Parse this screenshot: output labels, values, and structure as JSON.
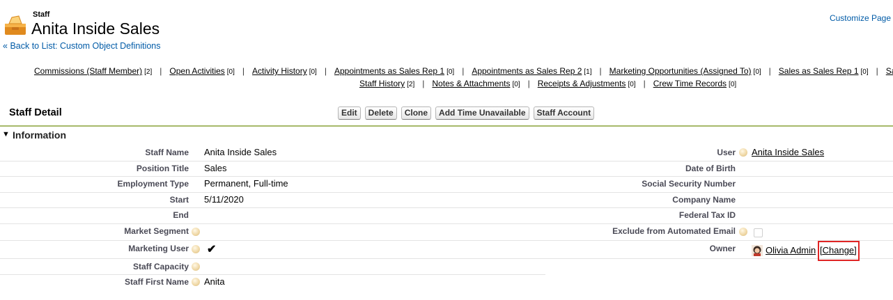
{
  "header": {
    "object_type": "Staff",
    "title": "Anita Inside Sales",
    "customize_link": "Customize Page",
    "back_prefix": "« ",
    "back_link": "Back to List: Custom Object Definitions"
  },
  "related_lists": {
    "row1": [
      {
        "label": "Commissions (Staff Member)",
        "count": "[2]"
      },
      {
        "label": "Open Activities",
        "count": "[0]"
      },
      {
        "label": "Activity History",
        "count": "[0]"
      },
      {
        "label": "Appointments as Sales Rep 1",
        "count": "[0]"
      },
      {
        "label": "Appointments as Sales Rep 2",
        "count": "[1]"
      },
      {
        "label": "Marketing Opportunities (Assigned To)",
        "count": "[0]"
      },
      {
        "label": "Sales as Sales Rep 1",
        "count": "[0]"
      },
      {
        "label": "Sale",
        "count": ""
      }
    ],
    "row2": [
      {
        "label": "Staff History",
        "count": "[2]"
      },
      {
        "label": "Notes & Attachments",
        "count": "[0]"
      },
      {
        "label": "Receipts & Adjustments",
        "count": "[0]"
      },
      {
        "label": "Crew Time Records",
        "count": "[0]"
      }
    ],
    "separator": "|"
  },
  "detail": {
    "title": "Staff Detail",
    "buttons": [
      "Edit",
      "Delete",
      "Clone",
      "Add Time Unavailable",
      "Staff Account"
    ],
    "section": "Information",
    "left_fields": [
      {
        "label": "Staff Name",
        "value": "Anita Inside Sales"
      },
      {
        "label": "Position Title",
        "value": "Sales"
      },
      {
        "label": "Employment Type",
        "value": "Permanent, Full-time"
      },
      {
        "label": "Start",
        "value": "5/11/2020"
      },
      {
        "label": "End",
        "value": ""
      },
      {
        "label": "Market Segment",
        "value": ""
      },
      {
        "label": "Marketing User",
        "value": "✔"
      },
      {
        "label": "Staff Capacity",
        "value": ""
      },
      {
        "label": "Staff First Name",
        "value": "Anita"
      }
    ],
    "right_fields": [
      {
        "label": "User",
        "value": "Anita Inside Sales"
      },
      {
        "label": "Date of Birth",
        "value": ""
      },
      {
        "label": "Social Security Number",
        "value": ""
      },
      {
        "label": "Company Name",
        "value": ""
      },
      {
        "label": "Federal Tax ID",
        "value": ""
      },
      {
        "label": "Exclude from Automated Email",
        "value": ""
      },
      {
        "label": "Owner",
        "value": "Olivia Admin",
        "change": "[Change]"
      }
    ]
  },
  "colors": {
    "link_blue": "#015ba7",
    "section_line": "#a6b96a",
    "highlight": "#e02424"
  },
  "icons": [
    "staff-object-icon",
    "help-icon",
    "checkmark-icon",
    "avatar-icon",
    "collapse-triangle-icon"
  ]
}
